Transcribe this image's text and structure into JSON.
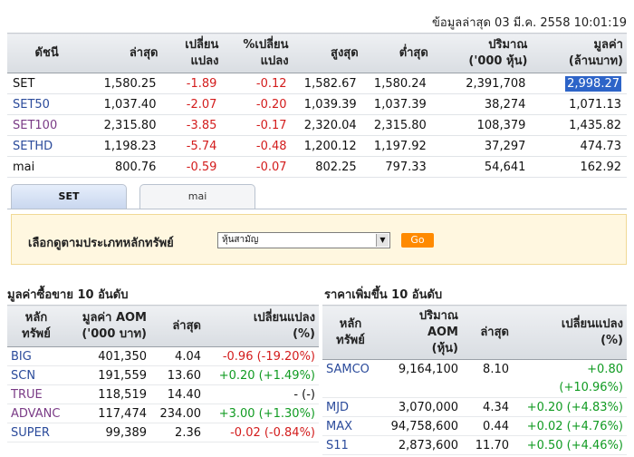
{
  "updated": "ข้อมูลล่าสุด 03 มี.ค. 2558 10:01:19",
  "index_table": {
    "headers": [
      "ดัชนี",
      "ล่าสุด",
      "เปลี่ยน\nแปลง",
      "%เปลี่ยน\nแปลง",
      "สูงสุด",
      "ต่ำสุด",
      "ปริมาณ\n('000 หุ้น)",
      "มูลค่า\n(ล้านบาท)"
    ],
    "rows": [
      {
        "name": "SET",
        "last": "1,580.25",
        "chg": "-1.89",
        "pct": "-0.12",
        "high": "1,582.67",
        "low": "1,580.24",
        "vol": "2,391,708",
        "value": "2,998.27"
      },
      {
        "name": "SET50",
        "last": "1,037.40",
        "chg": "-2.07",
        "pct": "-0.20",
        "high": "1,039.39",
        "low": "1,037.39",
        "vol": "38,274",
        "value": "1,071.13"
      },
      {
        "name": "SET100",
        "last": "2,315.80",
        "chg": "-3.85",
        "pct": "-0.17",
        "high": "2,320.04",
        "low": "2,315.80",
        "vol": "108,379",
        "value": "1,435.82"
      },
      {
        "name": "SETHD",
        "last": "1,198.23",
        "chg": "-5.74",
        "pct": "-0.48",
        "high": "1,200.12",
        "low": "1,197.92",
        "vol": "37,297",
        "value": "474.73"
      },
      {
        "name": "mai",
        "last": "800.76",
        "chg": "-0.59",
        "pct": "-0.07",
        "high": "802.25",
        "low": "797.33",
        "vol": "54,641",
        "value": "162.92"
      }
    ]
  },
  "tabs": {
    "set": "SET",
    "mai": "mai"
  },
  "filter": {
    "label": "เลือกดูตามประเภทหลักทรัพย์",
    "selected": "หุ้นสามัญ",
    "go": "Go"
  },
  "left_section": {
    "title": "มูลค่าซื้อขาย 10 อันดับ",
    "headers": [
      "หลัก\nทรัพย์",
      "มูลค่า AOM\n('000 บาท)",
      "ล่าสุด",
      "เปลี่ยนแปลง\n(%)"
    ],
    "rows": [
      {
        "sym": "BIG",
        "aom": "401,350",
        "last": "4.04",
        "chg": "-0.96 (-19.20%)",
        "dir": "neg",
        "color": "link"
      },
      {
        "sym": "SCN",
        "aom": "191,559",
        "last": "13.60",
        "chg": "+0.20 (+1.49%)",
        "dir": "pos",
        "color": "link"
      },
      {
        "sym": "TRUE",
        "aom": "118,519",
        "last": "14.40",
        "chg": "- (-)",
        "dir": "none",
        "color": "link-purple"
      },
      {
        "sym": "ADVANC",
        "aom": "117,474",
        "last": "234.00",
        "chg": "+3.00 (+1.30%)",
        "dir": "pos",
        "color": "link-purple"
      },
      {
        "sym": "SUPER",
        "aom": "99,389",
        "last": "2.36",
        "chg": "-0.02 (-0.84%)",
        "dir": "neg",
        "color": "link"
      }
    ]
  },
  "right_section": {
    "title": "ราคาเพิ่มขึ้น 10 อันดับ",
    "headers": [
      "หลัก\nทรัพย์",
      "ปริมาณ\nAOM\n(หุ้น)",
      "ล่าสุด",
      "เปลี่ยนแปลง\n(%)"
    ],
    "rows": [
      {
        "sym": "SAMCO",
        "aom": "9,164,100",
        "last": "8.10",
        "chg": "+0.80",
        "chg2": "(+10.96%)"
      },
      {
        "sym": "MJD",
        "aom": "3,070,000",
        "last": "4.34",
        "chg": "+0.20 (+4.83%)",
        "chg2": ""
      },
      {
        "sym": "MAX",
        "aom": "94,758,600",
        "last": "0.44",
        "chg": "+0.02 (+4.76%)",
        "chg2": ""
      },
      {
        "sym": "S11",
        "aom": "2,873,600",
        "last": "11.70",
        "chg": "+0.50 (+4.46%)",
        "chg2": ""
      }
    ]
  },
  "colors": {
    "negative": "#d31c1c",
    "positive": "#119b22",
    "link": "#2b4b9b",
    "highlight": "#2d64c8",
    "go_button": "#ff8a00"
  }
}
